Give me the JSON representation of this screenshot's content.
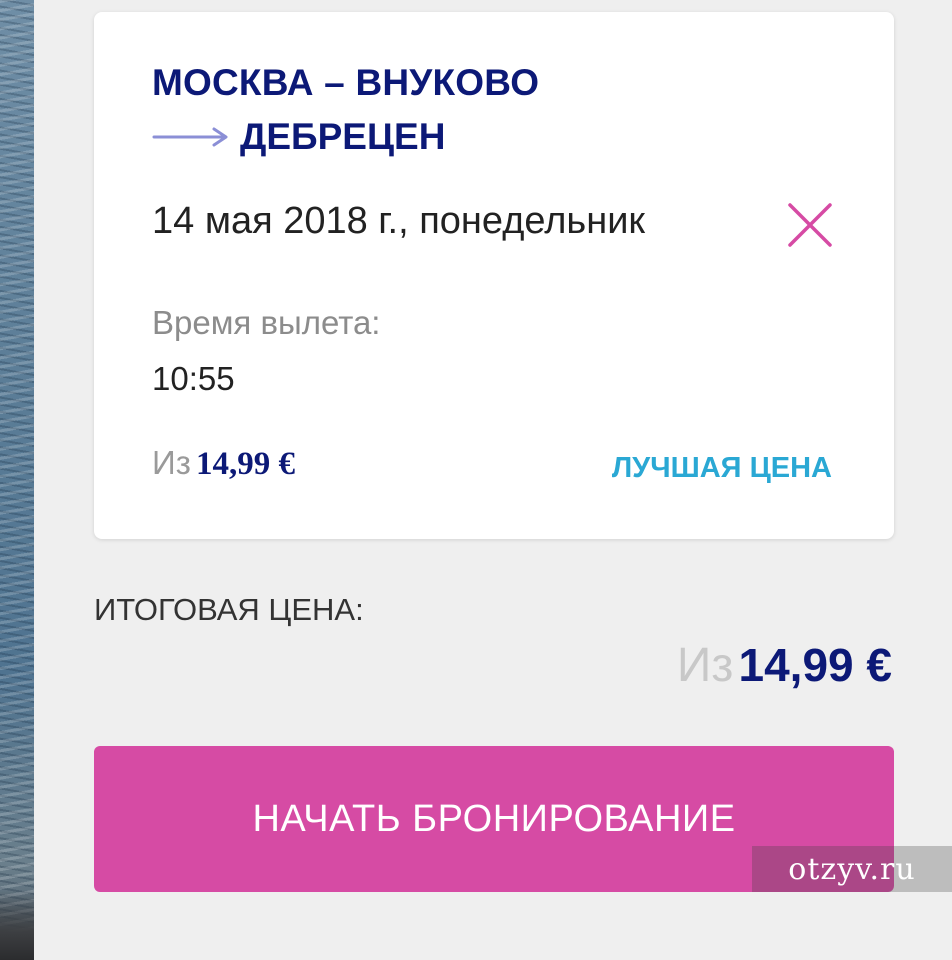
{
  "flight": {
    "route_from": "МОСКВА – ВНУКОВО",
    "route_to": "ДЕБРЕЦЕН",
    "date": "14 мая 2018 г., понедельник",
    "departure_label": "Время вылета:",
    "departure_time": "10:55",
    "price_prefix": "Из",
    "price": "14,99 €",
    "best_price_badge": "ЛУЧШАЯ ЦЕНА"
  },
  "summary": {
    "total_label": "ИТОГОВАЯ ЦЕНА:",
    "total_prefix": "Из",
    "total_price": "14,99 €"
  },
  "actions": {
    "book_label": "НАЧАТЬ БРОНИРОВАНИЕ"
  },
  "watermark": "otzyv.ru",
  "colors": {
    "route_text": "#0c1977",
    "accent_pink": "#d64ba4",
    "best_price": "#2aa8d4",
    "arrow": "#8b8fd6"
  },
  "icons": {
    "route_arrow": "arrow-right-icon",
    "remove": "close-icon"
  }
}
